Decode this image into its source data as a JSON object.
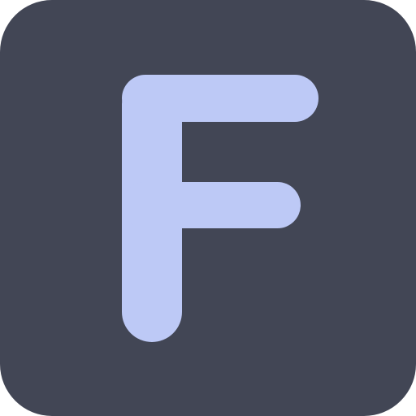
{
  "app_icon": {
    "name": "F",
    "letter_glyph": "F-letter-icon",
    "colors": {
      "tile": "#424655",
      "letter": "#BDC9F6"
    }
  }
}
